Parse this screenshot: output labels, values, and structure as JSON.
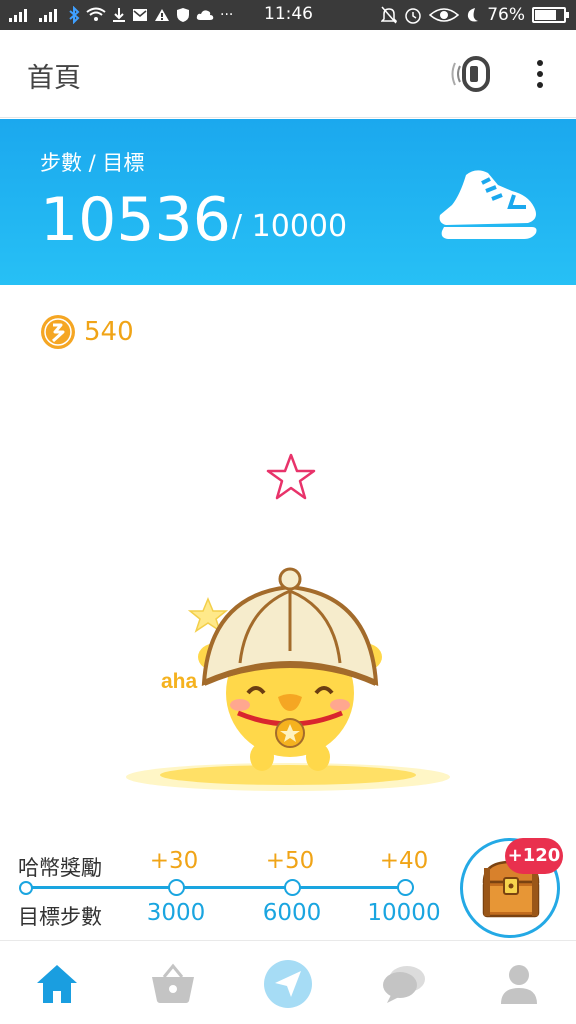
{
  "status_bar": {
    "time": "11:46",
    "battery_text": "76%",
    "battery_level": 0.76,
    "left_icons": [
      "signal-icon",
      "signal-icon",
      "bluetooth-icon",
      "wifi-icon",
      "download-icon",
      "mail-icon",
      "warning-icon",
      "shield-icon",
      "cloud-icon",
      "more-icon"
    ],
    "right_icons": [
      "silent-icon",
      "alarm-icon",
      "eye-icon",
      "moon-icon"
    ]
  },
  "app_bar": {
    "title": "首頁",
    "watch_icon": "watch-sync-icon",
    "menu_icon": "more-vertical-icon"
  },
  "steps": {
    "label": "步數 / 目標",
    "count": "10536",
    "goal": "/ 10000",
    "icon": "shoe-icon"
  },
  "coins": {
    "icon": "coin-icon",
    "value": "540"
  },
  "mascot": {
    "aha_text": "aha"
  },
  "rewards": {
    "coin_label": "哈幣獎勵",
    "steps_label": "目標步數",
    "milestones": [
      {
        "bonus": "+30",
        "steps": "3000"
      },
      {
        "bonus": "+50",
        "steps": "6000"
      },
      {
        "bonus": "+40",
        "steps": "10000"
      }
    ],
    "chest_badge": "+120",
    "chest_icon": "treasure-chest-icon"
  },
  "bottom_nav": {
    "items": [
      {
        "icon": "home-icon",
        "active": true
      },
      {
        "icon": "basket-icon",
        "active": false
      },
      {
        "icon": "send-icon",
        "active": false
      },
      {
        "icon": "chat-icon",
        "active": false
      },
      {
        "icon": "profile-icon",
        "active": false
      }
    ],
    "colors": {
      "active": "#1a9ee0",
      "inactive": "#c4c4c4"
    }
  },
  "colors": {
    "banner": "#1ba8ee",
    "accent_orange": "#f0a417",
    "accent_blue": "#1aa5e0",
    "badge_red": "#e9304e"
  }
}
